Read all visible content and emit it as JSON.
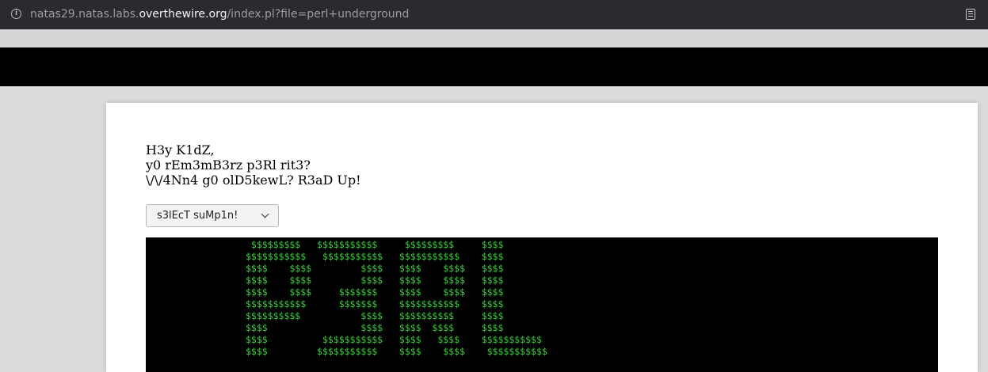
{
  "browser": {
    "url_prefix": "natas29.natas.labs.",
    "url_domain": "overthewire.org",
    "url_path": "/index.pl?file=perl+underground"
  },
  "page": {
    "greeting_lines": [
      "H3y K1dZ,",
      "y0 rEm3mB3rz p3Rl rit3?",
      "\\/\\/4Nn4 g0 olD5kewL? R3aD Up!"
    ],
    "select_label": "s3lEcT suMp1n!",
    "ascii_art": " $$$$$$$$$   $$$$$$$$$$$     $$$$$$$$$     $$$$\n$$$$$$$$$$$   $$$$$$$$$$$   $$$$$$$$$$$    $$$$\n$$$$    $$$$         $$$$   $$$$    $$$$   $$$$\n$$$$    $$$$         $$$$   $$$$    $$$$   $$$$\n$$$$    $$$$     $$$$$$$    $$$$    $$$$   $$$$\n$$$$$$$$$$$      $$$$$$$    $$$$$$$$$$$    $$$$\n$$$$$$$$$$           $$$$   $$$$$$$$$$     $$$$\n$$$$                 $$$$   $$$$  $$$$     $$$$\n$$$$          $$$$$$$$$$$   $$$$   $$$$    $$$$$$$$$$$\n$$$$         $$$$$$$$$$$    $$$$    $$$$    $$$$$$$$$$$"
  }
}
